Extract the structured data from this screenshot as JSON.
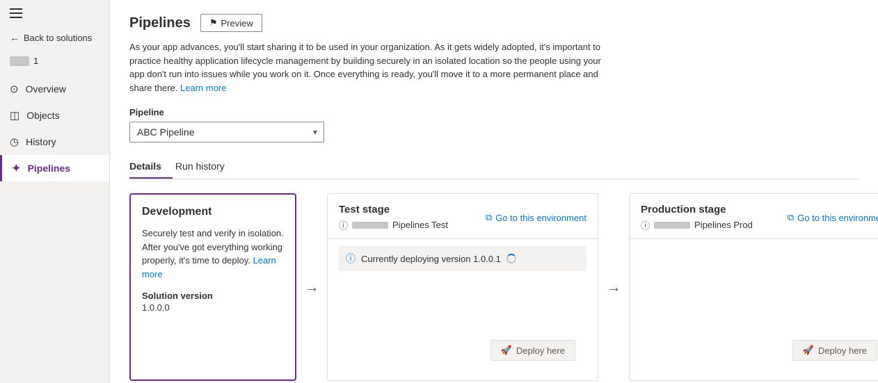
{
  "sidebar": {
    "hamburger_label": "Menu",
    "back_label": "Back to solutions",
    "user": {
      "number": "1"
    },
    "items": [
      {
        "id": "overview",
        "label": "Overview",
        "icon": "⊙",
        "active": false
      },
      {
        "id": "objects",
        "label": "Objects",
        "icon": "◫",
        "active": false
      },
      {
        "id": "history",
        "label": "History",
        "icon": "◷",
        "active": false
      },
      {
        "id": "pipelines",
        "label": "Pipelines",
        "icon": "✦",
        "active": true
      }
    ]
  },
  "main": {
    "title": "Pipelines",
    "preview_btn": "Preview",
    "description": "As your app advances, you'll start sharing it to be used in your organization. As it gets widely adopted, it's important to practice healthy application lifecycle management by building securely in an isolated location so the people using your app don't run into issues while you work on it. Once everything is ready, you'll move it to a more permanent place and share there.",
    "learn_more": "Learn more",
    "pipeline_label": "Pipeline",
    "pipeline_value": "ABC Pipeline",
    "tabs": [
      {
        "id": "details",
        "label": "Details",
        "active": true
      },
      {
        "id": "run-history",
        "label": "Run history",
        "active": false
      }
    ],
    "stages": {
      "dev": {
        "title": "Development",
        "description": "Securely test and verify in isolation. After you've got everything working properly, it's time to deploy.",
        "learn_more": "Learn more",
        "solution_label": "Solution version",
        "solution_version": "1.0.0.0"
      },
      "test": {
        "title": "Test stage",
        "env_name": "Pipelines Test",
        "goto_label": "Go to this environment",
        "deploying_text": "Currently deploying version 1.0.0.1",
        "deploy_label": "Deploy here"
      },
      "prod": {
        "title": "Production stage",
        "env_name": "Pipelines Prod",
        "goto_label": "Go to this environment",
        "deploy_label": "Deploy here"
      }
    }
  }
}
